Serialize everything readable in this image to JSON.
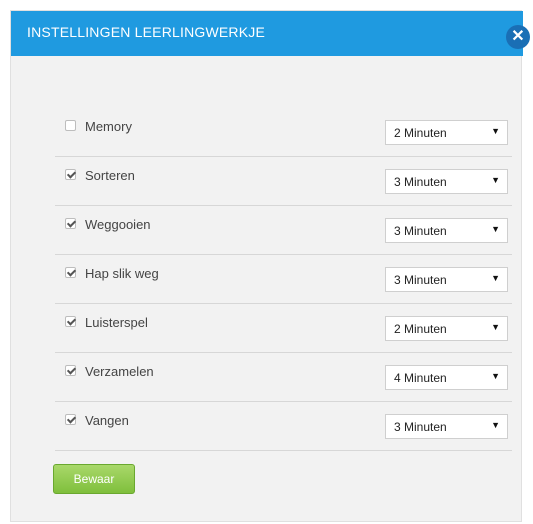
{
  "dialog": {
    "title": "INSTELLINGEN LEERLINGWERKJE",
    "close_icon": "close-icon",
    "save_label": "Bewaar"
  },
  "rows": [
    {
      "label": "Memory",
      "checked": false,
      "duration": "2 Minuten"
    },
    {
      "label": "Sorteren",
      "checked": true,
      "duration": "3 Minuten"
    },
    {
      "label": "Weggooien",
      "checked": true,
      "duration": "3 Minuten"
    },
    {
      "label": "Hap slik weg",
      "checked": true,
      "duration": "3 Minuten"
    },
    {
      "label": "Luisterspel",
      "checked": true,
      "duration": "2 Minuten"
    },
    {
      "label": "Verzamelen",
      "checked": true,
      "duration": "4 Minuten"
    },
    {
      "label": "Vangen",
      "checked": true,
      "duration": "3 Minuten"
    }
  ],
  "colors": {
    "header": "#1f9ae0",
    "close_button": "#1a6fb5",
    "save_button": "#8cc84b",
    "background": "#f2f2f2"
  }
}
